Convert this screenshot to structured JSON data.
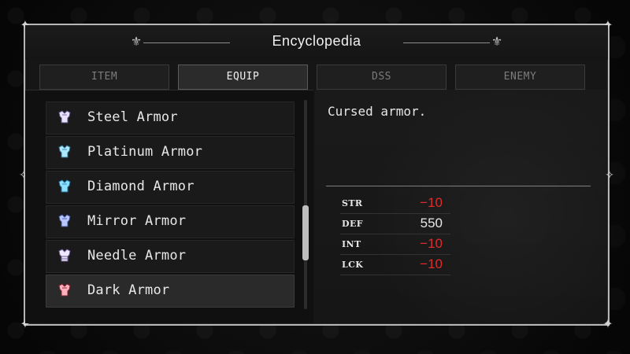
{
  "title": "Encyclopedia",
  "tabs": [
    {
      "label": "ITEM"
    },
    {
      "label": "EQUIP"
    },
    {
      "label": "DSS"
    },
    {
      "label": "ENEMY"
    }
  ],
  "active_tab": "EQUIP",
  "list": {
    "items": [
      {
        "label": "Steel Armor",
        "icon": "steel-armor-icon"
      },
      {
        "label": "Platinum Armor",
        "icon": "platinum-armor-icon"
      },
      {
        "label": "Diamond Armor",
        "icon": "diamond-armor-icon"
      },
      {
        "label": "Mirror Armor",
        "icon": "mirror-armor-icon"
      },
      {
        "label": "Needle Armor",
        "icon": "needle-armor-icon"
      },
      {
        "label": "Dark Armor",
        "icon": "dark-armor-icon"
      }
    ],
    "selected": "Dark Armor"
  },
  "details": {
    "description": "Cursed armor.",
    "stats": [
      {
        "label": "STR",
        "value": "−10",
        "negative": true
      },
      {
        "label": "DEF",
        "value": "550",
        "negative": false
      },
      {
        "label": "INT",
        "value": "−10",
        "negative": true
      },
      {
        "label": "LCK",
        "value": "−10",
        "negative": true
      }
    ]
  },
  "colors": {
    "negative_stat": "#e02b2b",
    "text_primary": "#e8e8e8",
    "frame": "#b7b7b7"
  }
}
